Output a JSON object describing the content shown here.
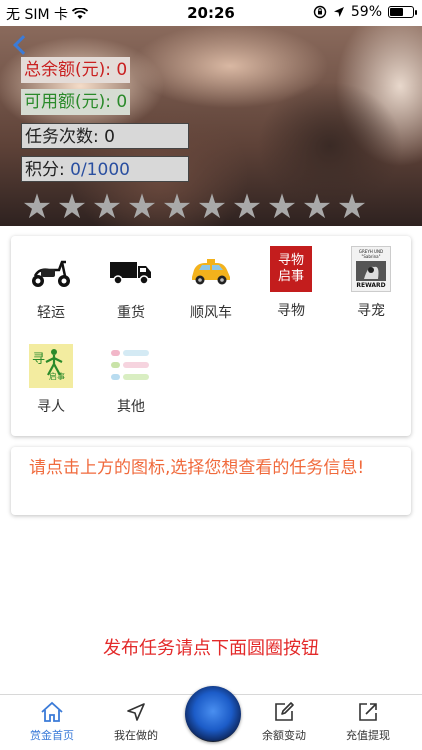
{
  "status_bar": {
    "carrier": "无 SIM 卡",
    "time": "20:26",
    "battery": "59%",
    "battery_level": 0.59
  },
  "header": {
    "total_balance": "总余额(元): 0",
    "available_balance": "可用额(元): 0",
    "task_count": "任务次数: 0",
    "points_label": "积分: ",
    "points_value": "0/1000",
    "rating_filled": 0,
    "rating_total": 10
  },
  "categories": [
    {
      "label": "轻运",
      "icon": "scooter-icon"
    },
    {
      "label": "重货",
      "icon": "truck-icon"
    },
    {
      "label": "顺风车",
      "icon": "taxi-icon"
    },
    {
      "label": "寻物",
      "icon": "lost-item-notice-icon",
      "icon_text_1": "寻物",
      "icon_text_2": "启事"
    },
    {
      "label": "寻宠",
      "icon": "reward-poster-icon",
      "icon_text_top": "GREYH UND \"Sabrina\"",
      "icon_text_bottom": "REWARD"
    },
    {
      "label": "寻人",
      "icon": "missing-person-icon",
      "icon_text_1": "寻",
      "icon_text_2": "启事"
    },
    {
      "label": "其他",
      "icon": "list-icon"
    }
  ],
  "message": "请点击上方的图标,选择您想查看的任务信息!",
  "publish_hint": "发布任务请点下面圆圈按钮",
  "tabbar": {
    "items": [
      {
        "label": "赏金首页",
        "icon": "home-icon",
        "active": true
      },
      {
        "label": "我在做的",
        "icon": "navigation-icon",
        "active": false
      },
      {
        "label": "余额变动",
        "icon": "edit-icon",
        "active": false
      },
      {
        "label": "充值提现",
        "icon": "share-icon",
        "active": false
      }
    ]
  },
  "colors": {
    "accent": "#3b7bd8",
    "balance_red": "#c92020",
    "available_green": "#2a8a2a",
    "message_orange": "#f06a3c",
    "hint_red": "#e32a2a"
  }
}
